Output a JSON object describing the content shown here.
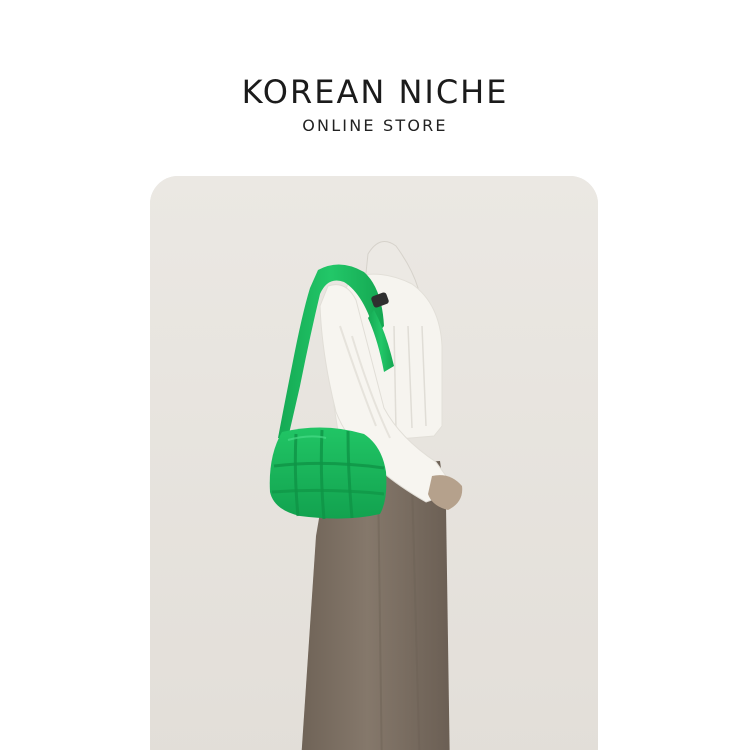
{
  "header": {
    "brand_title": "KOREAN NICHE",
    "brand_subtitle": "ONLINE STORE"
  },
  "product_photo": {
    "subject": "green quilted shoulder bag on mannequin",
    "colors": {
      "background": "#e7e4df",
      "bag": "#19b65a",
      "blouse": "#f5f3ee",
      "skirt": "#7a6d60"
    }
  }
}
